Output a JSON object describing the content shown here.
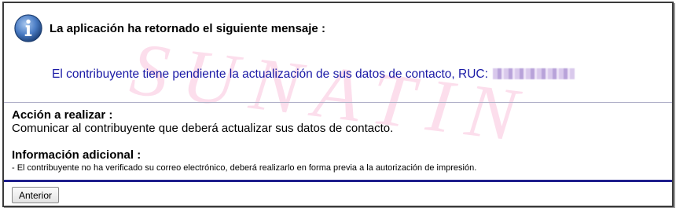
{
  "watermark": "SUNATIN",
  "header": {
    "icon": "info-icon",
    "title": "La aplicación ha retornado el siguiente mensaje :"
  },
  "message": {
    "text": "El contribuyente tiene pendiente la actualización de sus datos de contacto, RUC:"
  },
  "action": {
    "heading": "Acción a realizar :",
    "text": "Comunicar al contribuyente que deberá actualizar sus datos de contacto."
  },
  "additional_info": {
    "heading": "Información adicional :",
    "text": "- El contribuyente no ha verificado su correo electrónico, deberá realizarlo en forma previa a la autorización de impresión."
  },
  "buttons": {
    "back_label": "Anterior"
  },
  "colors": {
    "message_text": "#1a1aa6",
    "separator": "#1e1e8c",
    "watermark": "#fbd3e6"
  }
}
